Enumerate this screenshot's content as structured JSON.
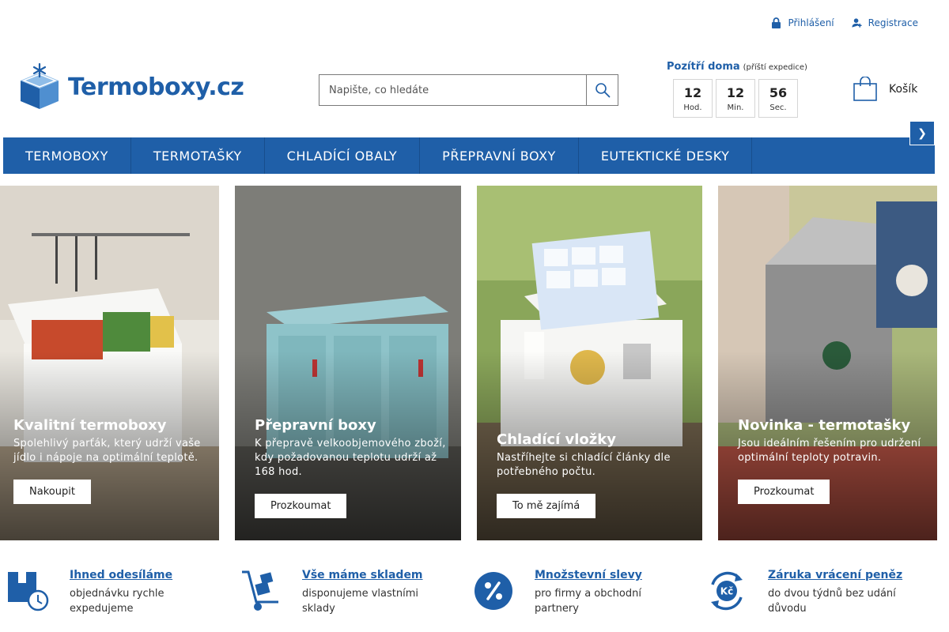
{
  "header": {
    "login": "Přihlášení",
    "register": "Registrace",
    "logo": "Termoboxy.cz",
    "search_placeholder": "Napište, co hledáte",
    "countdown": {
      "title": "Pozítří doma",
      "subtitle": "(příští expedice)",
      "units": [
        {
          "value": "12",
          "label": "Hod."
        },
        {
          "value": "12",
          "label": "Min."
        },
        {
          "value": "56",
          "label": "Sec."
        }
      ]
    },
    "cart": "Košík"
  },
  "nav": {
    "items": [
      "TERMOBOXY",
      "TERMOTAŠKY",
      "CHLADÍCÍ OBALY",
      "PŘEPRAVNÍ BOXY",
      "EUTEKTICKÉ DESKY"
    ],
    "toggle_icon": "chevron-icon"
  },
  "banners": [
    {
      "title": "Kvalitní termoboxy",
      "text": "Spolehlivý parťák, který udrží vaše jídlo i nápoje na optimální teplotě.",
      "button": "Nakoupit"
    },
    {
      "title": "Přepravní boxy",
      "text": "K přepravě velkoobjemového zboží, kdy požadovanou teplotu udrží až 168 hod.",
      "button": "Prozkoumat"
    },
    {
      "title": "Chladící vložky",
      "text": "Nastříhejte si chladící články dle potřebného počtu.",
      "button": "To mě zajímá"
    },
    {
      "title": "Novinka - termotašky",
      "text": "Jsou ideálním řešením pro udržení optimální teploty potravin.",
      "button": "Prozkoumat"
    }
  ],
  "features": [
    {
      "title": "Ihned odesíláme",
      "text": "objednávku rychle expedujeme",
      "icon": "box-clock-icon"
    },
    {
      "title": "Vše máme skladem",
      "text": "disponujeme vlastními sklady",
      "icon": "hand-truck-icon"
    },
    {
      "title": "Množstevní slevy",
      "text": "pro firmy a obchodní partnery",
      "icon": "percent-badge-icon"
    },
    {
      "title": "Záruka vrácení peněz",
      "text": "do dvou týdnů bez udání důvodu",
      "icon": "money-back-icon"
    }
  ],
  "colors": {
    "brand": "#1f5fa8",
    "text": "#2a2a2a"
  }
}
